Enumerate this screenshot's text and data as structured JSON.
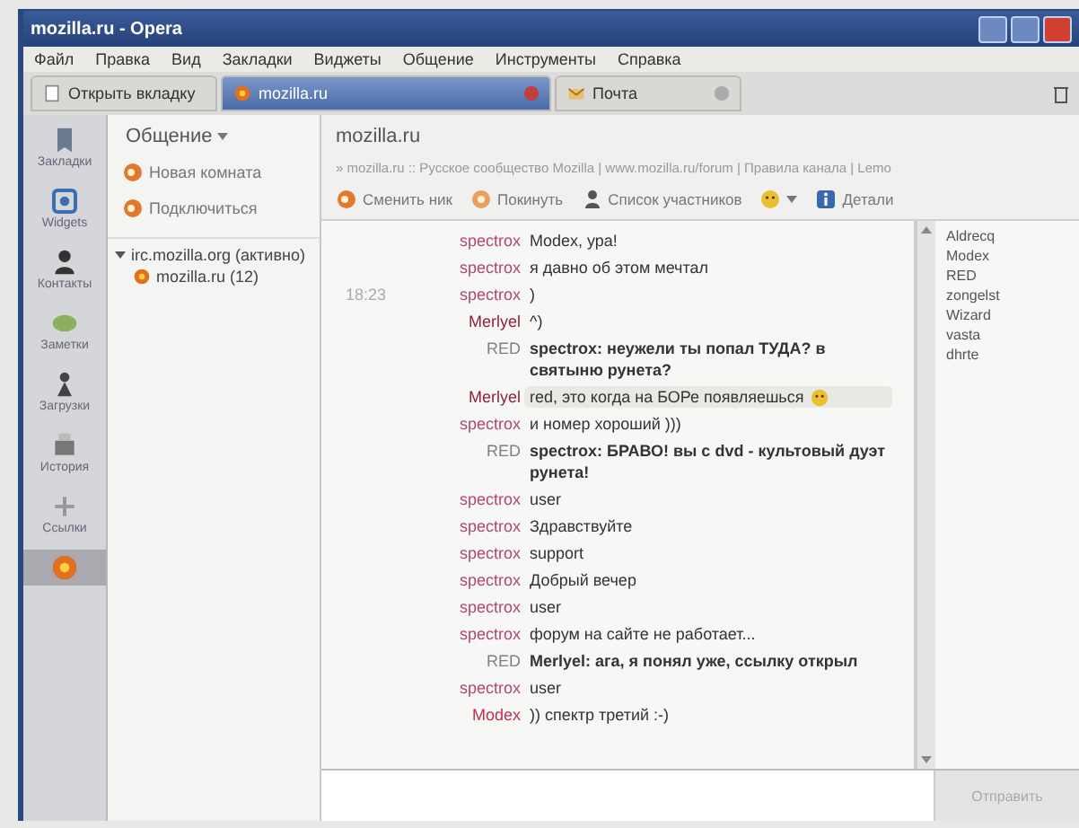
{
  "window": {
    "title": "mozilla.ru - Opera"
  },
  "menu": [
    "Файл",
    "Правка",
    "Вид",
    "Закладки",
    "Виджеты",
    "Общение",
    "Инструменты",
    "Справка"
  ],
  "tabs": [
    {
      "label": "Открыть вкладку",
      "selected": false,
      "kind": "new"
    },
    {
      "label": "mozilla.ru",
      "selected": true,
      "kind": "chat"
    },
    {
      "label": "Почта",
      "selected": false,
      "kind": "mail"
    }
  ],
  "sidebar": {
    "items": [
      {
        "kind": "bookmarks",
        "label": "Закладки",
        "selected": false
      },
      {
        "kind": "widgets",
        "label": "Widgets",
        "selected": false
      },
      {
        "kind": "contacts",
        "label": "Контакты",
        "selected": false
      },
      {
        "kind": "notes",
        "label": "Заметки",
        "selected": false
      },
      {
        "kind": "transfers",
        "label": "Загрузки",
        "selected": false
      },
      {
        "kind": "history",
        "label": "История",
        "selected": false
      },
      {
        "kind": "links",
        "label": "Ссылки",
        "selected": false
      },
      {
        "kind": "chat",
        "selected": true
      }
    ]
  },
  "panel": {
    "title": "Общение",
    "actions": [
      "Новая комната",
      "Подключиться"
    ],
    "tree": [
      {
        "label": "irc.mozilla.org (активно)",
        "expanded": true,
        "children": [
          {
            "label": "mozilla.ru (12)"
          }
        ]
      }
    ]
  },
  "chat": {
    "title": "mozilla.ru",
    "topic": "» mozilla.ru :: Русское сообщество Mozilla | www.mozilla.ru/forum | Правила канала | Lemo",
    "toolbar": [
      {
        "kind": "user",
        "label": "Сменить ник"
      },
      {
        "kind": "exit",
        "label": "Покинуть"
      },
      {
        "kind": "person",
        "label": "Список участников"
      },
      {
        "kind": "smiley"
      },
      {
        "kind": "info",
        "label": "Детали"
      }
    ],
    "messages": [
      {
        "nick": "spectrox",
        "color": "#b04870",
        "text": "Modex, ура!",
        "bold": false,
        "highlighted": false,
        "emoticon": false
      },
      {
        "nick": "spectrox",
        "color": "#b04870",
        "text": "я давно об этом мечтал",
        "bold": false,
        "highlighted": false,
        "emoticon": false
      },
      {
        "time": "18:23",
        "nick": "spectrox",
        "color": "#b04870",
        "text": ")",
        "bold": false,
        "highlighted": false,
        "emoticon": false
      },
      {
        "nick": "Merlyel",
        "color": "#902040",
        "text": "^)",
        "bold": false,
        "highlighted": false,
        "emoticon": false
      },
      {
        "nick": "RED",
        "color": "#808080",
        "text": "spectrox: неужели ты попал ТУДА? в святыню рунета?",
        "bold": true,
        "highlighted": false,
        "emoticon": false
      },
      {
        "nick": "Merlyel",
        "color": "#902040",
        "text": "red, это когда на БОРе появляешься",
        "bold": false,
        "highlighted": true,
        "emoticon": true
      },
      {
        "nick": "spectrox",
        "color": "#b04870",
        "text": "и номер хороший )))",
        "bold": false,
        "highlighted": false,
        "emoticon": false
      },
      {
        "nick": "RED",
        "color": "#808080",
        "text": "spectrox: БРАВО! вы с dvd - культовый дуэт рунета!",
        "bold": true,
        "highlighted": false,
        "emoticon": false
      },
      {
        "nick": "spectrox",
        "color": "#b04870",
        "text": "user",
        "bold": false,
        "highlighted": false,
        "emoticon": false
      },
      {
        "nick": "spectrox",
        "color": "#b04870",
        "text": "Здравствуйте",
        "bold": false,
        "highlighted": false,
        "emoticon": false
      },
      {
        "nick": "spectrox",
        "color": "#b04870",
        "text": "support",
        "bold": false,
        "highlighted": false,
        "emoticon": false
      },
      {
        "nick": "spectrox",
        "color": "#b04870",
        "text": "Добрый вечер",
        "bold": false,
        "highlighted": false,
        "emoticon": false
      },
      {
        "nick": "spectrox",
        "color": "#b04870",
        "text": "user",
        "bold": false,
        "highlighted": false,
        "emoticon": false
      },
      {
        "nick": "spectrox",
        "color": "#b04870",
        "text": "форум на сайте не работает...",
        "bold": false,
        "highlighted": false,
        "emoticon": false
      },
      {
        "nick": "RED",
        "color": "#808080",
        "text": "Merlyel: ага, я понял уже, ссылку открыл",
        "bold": true,
        "highlighted": false,
        "emoticon": false
      },
      {
        "nick": "spectrox",
        "color": "#b04870",
        "text": "user",
        "bold": false,
        "highlighted": false,
        "emoticon": false
      },
      {
        "nick": "Modex",
        "color": "#c03050",
        "text": ")) спектр третий :-)",
        "bold": false,
        "highlighted": false,
        "emoticon": false
      }
    ],
    "nicks": [
      "Aldrecq",
      "Modex",
      "RED",
      "zongelst",
      "Wizard",
      "vasta",
      "dhrte"
    ],
    "send_button": "Отправить"
  }
}
